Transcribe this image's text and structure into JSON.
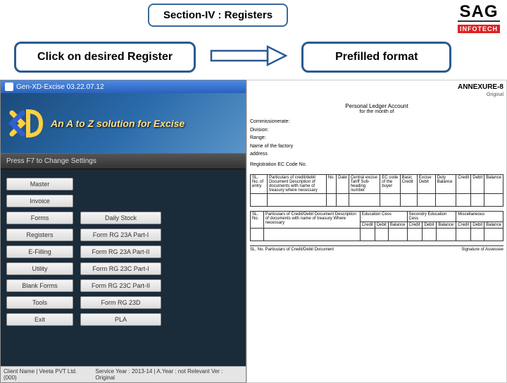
{
  "brand": {
    "name": "SAG",
    "sub": "INFOTECH"
  },
  "section_title": "Section-IV :  Registers",
  "instructions": {
    "left": "Click on desired Register",
    "right": "Prefilled format"
  },
  "app": {
    "window_title": "Gen-XD-Excise 03.22.07.12",
    "banner_tagline": "An A to Z solution for Excise",
    "f7_message": "Press F7 to Change Settings",
    "status_left": "Client Name | Veeta PVT Ltd. (000)",
    "status_right": "Service Year : 2013-14 | A.Year : not Relevant   Ver : Original"
  },
  "main_menu": [
    "Master",
    "Invoice",
    "Forms",
    "Registers",
    "E-Filling",
    "Utility",
    "Blank Forms",
    "Tools",
    "Exit"
  ],
  "sub_menu": [
    "Daily Stock",
    "Form RG 23A Part-I",
    "Form RG 23A Part-II",
    "Form RG 23C Part-I",
    "Form RG 23C Part-II",
    "Form RG 23D",
    "PLA"
  ],
  "annexure": {
    "head": "ANNEXURE-8",
    "original": "Original",
    "title": "Personal Ledger Account",
    "subtitle": "for the month of",
    "labels": [
      "Commissionerate:",
      "Division:",
      "Range:",
      "Name of the factory",
      "address",
      "Registration EC Code No."
    ],
    "table1_headers": [
      "SL. No. of entry",
      "Particulars of credit/debit Document Description of documents with name of treasury where necessary",
      "No.",
      "Date",
      "Central excise Tariff Sub-heading number",
      "EC code of the buyer",
      "Basic Credit",
      "Excise Debit",
      "Duty Balance",
      "Credit",
      "Debit",
      "Balance"
    ],
    "table2_headers": [
      "SL. No.",
      "Particulars of Credit/Debit Document Description of documents with name of treasury Where necessary",
      "Education Cess",
      "Secondry Education Cess",
      "Miscellaneous"
    ],
    "table2_sub": [
      "Credit",
      "Debit",
      "Balance",
      "Credit",
      "Debit",
      "Balance",
      "Credit",
      "Debit",
      "Balance"
    ],
    "sig_left": "SL. No.    Particulars of Credit/Debit Document",
    "sig_right": "Signature of Assessee"
  }
}
